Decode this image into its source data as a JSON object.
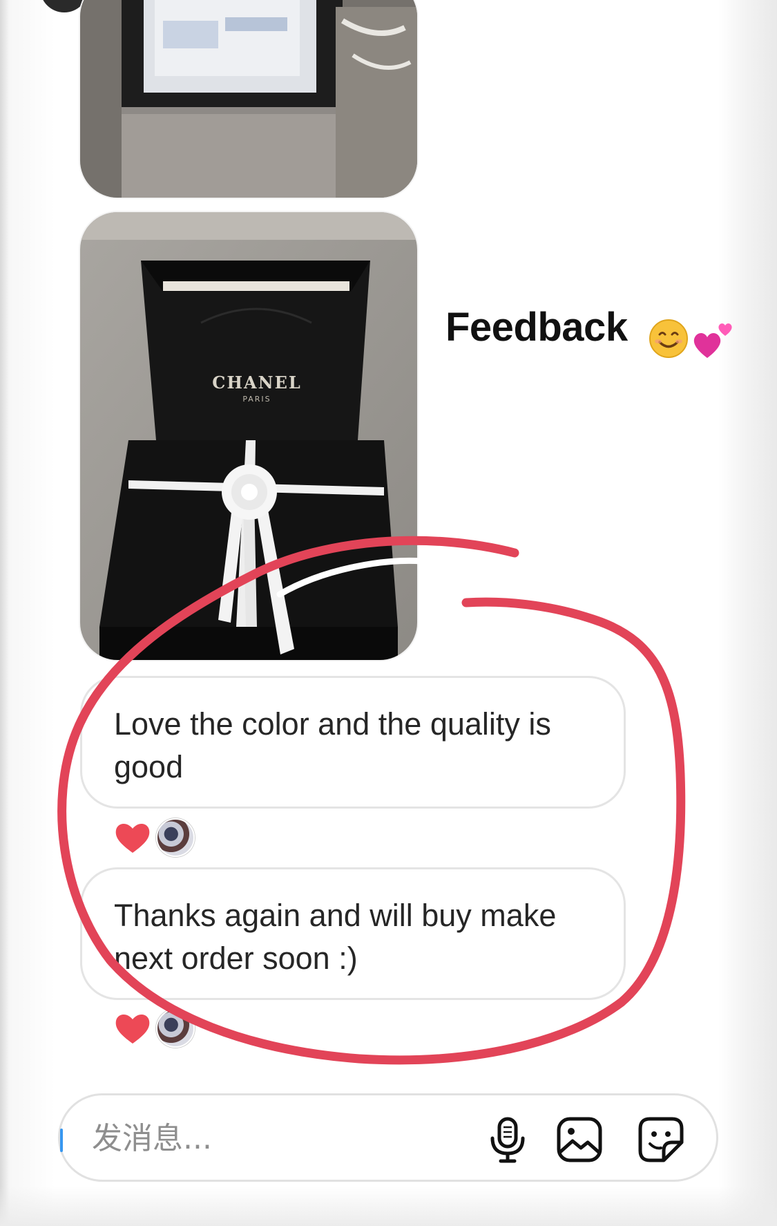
{
  "conversation": {
    "caption": "Feedback",
    "caption_emojis": [
      "smiling-face-emoji",
      "two-hearts-emoji"
    ],
    "photos": [
      {
        "subject": "packaging-box-photo"
      },
      {
        "subject": "gift-box-and-shopping-bag-photo",
        "bag_brand": "CHANEL",
        "bag_city": "PARIS"
      }
    ],
    "messages": [
      {
        "text": "Love the color and the quality is good",
        "reaction": "heart"
      },
      {
        "text": "Thanks again and will buy make next order soon :)",
        "reaction": "heart"
      }
    ]
  },
  "composer": {
    "placeholder": "发消息...",
    "icons": [
      "microphone-icon",
      "gallery-icon",
      "sticker-icon"
    ]
  },
  "colors": {
    "annotation_circle": "#e24458",
    "heart": "#ed4956",
    "bubble_border": "#e4e4e4"
  }
}
